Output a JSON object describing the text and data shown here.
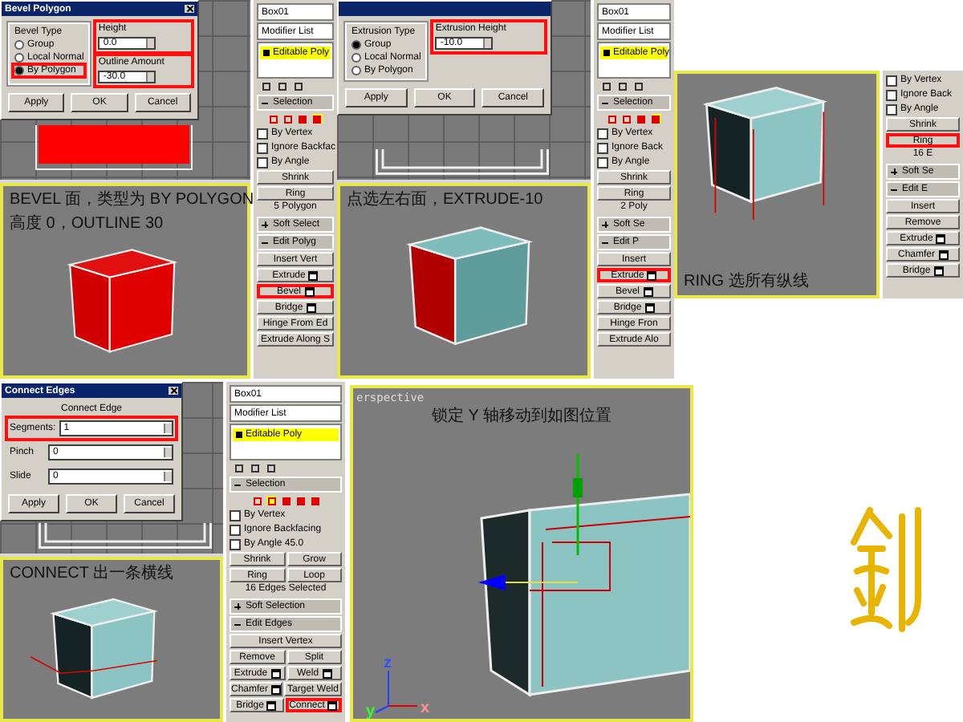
{
  "panels": [
    {
      "dialog": {
        "title": "Bevel Polygon",
        "group_label": "Bevel Type",
        "radios": [
          {
            "label": "Group",
            "selected": false,
            "highlighted": false
          },
          {
            "label": "Local Normal",
            "selected": false,
            "highlighted": false
          },
          {
            "label": "By Polygon",
            "selected": true,
            "highlighted": true
          }
        ],
        "fields": [
          {
            "label": "Height",
            "value": "0.0",
            "highlighted": true
          },
          {
            "label": "Outline Amount",
            "value": "-30.0",
            "highlighted": true
          }
        ],
        "buttons": [
          "Apply",
          "OK",
          "Cancel"
        ]
      },
      "top_view": {
        "kind": "red_plane"
      },
      "viewport": {
        "kind": "bevel_box",
        "captions": [
          "BEVEL 面，类型为 BY POLYGON",
          "高度 0，OUTLINE 30"
        ]
      },
      "command_panel": [
        {
          "kind": "field",
          "text": "Box01"
        },
        {
          "kind": "dropdown",
          "text": "Modifier List"
        },
        {
          "kind": "stack",
          "text": "Editable Poly"
        },
        {
          "kind": "stack_tools"
        },
        {
          "kind": "rollout",
          "text": "Selection",
          "expanded": true
        },
        {
          "kind": "levels",
          "levels": [
            {
              "selected": false
            },
            {
              "selected": false
            },
            {
              "selected": false
            },
            {
              "selected": true
            }
          ]
        },
        {
          "kind": "check",
          "text": "By Vertex",
          "checked": false
        },
        {
          "kind": "check",
          "text": "Ignore Backfac",
          "checked": false
        },
        {
          "kind": "check",
          "text": "By Angle",
          "checked": false
        },
        {
          "kind": "buttons",
          "buttons": [
            {
              "text": "Shrink",
              "settings": false,
              "highlighted": false
            }
          ]
        },
        {
          "kind": "buttons",
          "buttons": [
            {
              "text": "Ring",
              "settings": false,
              "highlighted": false
            }
          ]
        },
        {
          "kind": "note",
          "text": "5 Polygon"
        },
        {
          "kind": "rollout",
          "text": "Soft Select",
          "expanded": false
        },
        {
          "kind": "rollout",
          "text": "Edit Polyg",
          "expanded": true
        },
        {
          "kind": "buttons",
          "buttons": [
            {
              "text": "Insert Vert",
              "settings": false,
              "highlighted": false
            }
          ]
        },
        {
          "kind": "buttons",
          "buttons": [
            {
              "text": "Extrude",
              "settings": true,
              "highlighted": false
            }
          ]
        },
        {
          "kind": "buttons",
          "buttons": [
            {
              "text": "Bevel",
              "settings": true,
              "highlighted": true
            }
          ]
        },
        {
          "kind": "buttons",
          "buttons": [
            {
              "text": "Bridge",
              "settings": true,
              "highlighted": false
            }
          ]
        },
        {
          "kind": "buttons",
          "buttons": [
            {
              "text": "Hinge From Ed",
              "settings": false,
              "highlighted": false
            }
          ]
        },
        {
          "kind": "buttons",
          "buttons": [
            {
              "text": "Extrude Along S",
              "settings": false,
              "highlighted": false
            }
          ]
        }
      ]
    },
    {
      "dialog": {
        "group_label": "Extrusion Type",
        "radios": [
          {
            "label": "Group",
            "selected": true,
            "highlighted": false
          },
          {
            "label": "Local Normal",
            "selected": false,
            "highlighted": false
          },
          {
            "label": "By Polygon",
            "selected": false,
            "highlighted": false
          }
        ],
        "fields": [
          {
            "label": "Extrusion Height",
            "value": "-10.0",
            "highlighted": true
          }
        ],
        "buttons": [
          "Apply",
          "OK",
          "Cancel"
        ]
      },
      "top_view": {
        "kind": "box_outline"
      },
      "viewport": {
        "kind": "extruded_box",
        "captions": [
          "点选左右面，EXTRUDE-10"
        ]
      },
      "command_panel": [
        {
          "kind": "field",
          "text": "Box01"
        },
        {
          "kind": "dropdown",
          "text": "Modifier List"
        },
        {
          "kind": "stack",
          "text": "Editable Poly"
        },
        {
          "kind": "stack_tools"
        },
        {
          "kind": "rollout",
          "text": "Selection",
          "expanded": true
        },
        {
          "kind": "levels",
          "levels": [
            {
              "selected": false
            },
            {
              "selected": false
            },
            {
              "selected": false
            },
            {
              "selected": true
            }
          ]
        },
        {
          "kind": "check",
          "text": "By Vertex",
          "checked": false
        },
        {
          "kind": "check",
          "text": "Ignore Back",
          "checked": false
        },
        {
          "kind": "check",
          "text": "By Angle",
          "checked": false
        },
        {
          "kind": "buttons",
          "buttons": [
            {
              "text": "Shrink",
              "settings": false,
              "highlighted": false
            }
          ]
        },
        {
          "kind": "buttons",
          "buttons": [
            {
              "text": "Ring",
              "settings": false,
              "highlighted": false
            }
          ]
        },
        {
          "kind": "note",
          "text": "2 Poly"
        },
        {
          "kind": "rollout",
          "text": "Soft Se",
          "expanded": false
        },
        {
          "kind": "rollout",
          "text": "Edit P",
          "expanded": true
        },
        {
          "kind": "buttons",
          "buttons": [
            {
              "text": "Insert",
              "settings": false,
              "highlighted": false
            }
          ]
        },
        {
          "kind": "buttons",
          "buttons": [
            {
              "text": "Extrude",
              "settings": true,
              "highlighted": true
            }
          ]
        },
        {
          "kind": "buttons",
          "buttons": [
            {
              "text": "Bevel",
              "settings": true,
              "highlighted": false
            }
          ]
        },
        {
          "kind": "buttons",
          "buttons": [
            {
              "text": "Bridge",
              "settings": true,
              "highlighted": false
            }
          ]
        },
        {
          "kind": "buttons",
          "buttons": [
            {
              "text": "Hinge Fron",
              "settings": false,
              "highlighted": false
            }
          ]
        },
        {
          "kind": "buttons",
          "buttons": [
            {
              "text": "Extrude Alo",
              "settings": false,
              "highlighted": false
            }
          ]
        }
      ]
    },
    {
      "viewport": {
        "kind": "ring_box",
        "captions": [
          "RING 选所有纵线"
        ]
      },
      "command_panel": [
        {
          "kind": "check",
          "text": "By Vertex",
          "checked": false
        },
        {
          "kind": "check",
          "text": "Ignore Back",
          "checked": false
        },
        {
          "kind": "check",
          "text": "By Angle",
          "checked": false
        },
        {
          "kind": "buttons",
          "buttons": [
            {
              "text": "Shrink",
              "settings": false,
              "highlighted": false
            }
          ]
        },
        {
          "kind": "buttons",
          "buttons": [
            {
              "text": "Ring",
              "settings": false,
              "highlighted": true
            }
          ]
        },
        {
          "kind": "note",
          "text": "16 E"
        },
        {
          "kind": "rollout",
          "text": "Soft Se",
          "expanded": false
        },
        {
          "kind": "rollout",
          "text": "Edit E",
          "expanded": true
        },
        {
          "kind": "buttons",
          "buttons": [
            {
              "text": "Insert",
              "settings": false,
              "highlighted": false
            }
          ]
        },
        {
          "kind": "buttons",
          "buttons": [
            {
              "text": "Remove",
              "settings": false,
              "highlighted": false
            }
          ]
        },
        {
          "kind": "buttons",
          "buttons": [
            {
              "text": "Extrude",
              "settings": true,
              "highlighted": false
            }
          ]
        },
        {
          "kind": "buttons",
          "buttons": [
            {
              "text": "Chamfer",
              "settings": true,
              "highlighted": false
            }
          ]
        },
        {
          "kind": "buttons",
          "buttons": [
            {
              "text": "Bridge",
              "settings": true,
              "highlighted": false
            }
          ]
        }
      ]
    },
    {
      "dialog": {
        "title": "Connect Edges",
        "group_label": "Connect Edge",
        "fields": [
          {
            "label": "Segments:",
            "value": "1",
            "highlighted": true
          },
          {
            "label": "Pinch",
            "value": "0",
            "highlighted": false
          },
          {
            "label": "Slide",
            "value": "0",
            "highlighted": false
          }
        ],
        "buttons": [
          "Apply",
          "OK",
          "Cancel"
        ]
      },
      "top_view": {
        "kind": "box_outline"
      },
      "viewport": {
        "kind": "connected_box",
        "captions": [
          "CONNECT 出一条横线"
        ]
      },
      "command_panel": [
        {
          "kind": "field",
          "text": "Box01"
        },
        {
          "kind": "dropdown",
          "text": "Modifier List"
        },
        {
          "kind": "stack",
          "text": "Editable Poly"
        },
        {
          "kind": "stack_tools"
        },
        {
          "kind": "rollout",
          "text": "Selection",
          "expanded": true
        },
        {
          "kind": "levels",
          "levels": [
            {
              "selected": false
            },
            {
              "selected": true
            },
            {
              "selected": false
            },
            {
              "selected": false
            },
            {
              "selected": false
            }
          ]
        },
        {
          "kind": "check",
          "text": "By Vertex",
          "checked": false
        },
        {
          "kind": "check",
          "text": "Ignore Backfacing",
          "checked": false
        },
        {
          "kind": "check",
          "text": "By Angle  45.0",
          "checked": false
        },
        {
          "kind": "buttons",
          "buttons": [
            {
              "text": "Shrink",
              "settings": false,
              "highlighted": false
            },
            {
              "text": "Grow",
              "settings": false,
              "highlighted": false
            }
          ]
        },
        {
          "kind": "buttons",
          "buttons": [
            {
              "text": "Ring",
              "settings": false,
              "highlighted": false
            },
            {
              "text": "Loop",
              "settings": false,
              "highlighted": false
            }
          ]
        },
        {
          "kind": "note",
          "text": "16 Edges Selected"
        },
        {
          "kind": "rollout",
          "text": "Soft Selection",
          "expanded": false
        },
        {
          "kind": "rollout",
          "text": "Edit Edges",
          "expanded": true
        },
        {
          "kind": "buttons",
          "buttons": [
            {
              "text": "Insert Vertex",
              "settings": false,
              "highlighted": false
            }
          ]
        },
        {
          "kind": "buttons",
          "buttons": [
            {
              "text": "Remove",
              "settings": false,
              "highlighted": false
            },
            {
              "text": "Split",
              "settings": false,
              "highlighted": false
            }
          ]
        },
        {
          "kind": "buttons",
          "buttons": [
            {
              "text": "Extrude",
              "settings": true,
              "highlighted": false
            },
            {
              "text": "Weld",
              "settings": true,
              "highlighted": false
            }
          ]
        },
        {
          "kind": "buttons",
          "buttons": [
            {
              "text": "Chamfer",
              "settings": true,
              "highlighted": false
            },
            {
              "text": "Target Weld",
              "settings": false,
              "highlighted": false
            }
          ]
        },
        {
          "kind": "buttons",
          "buttons": [
            {
              "text": "Bridge",
              "settings": true,
              "highlighted": false
            },
            {
              "text": "Connect",
              "settings": true,
              "highlighted": true
            }
          ]
        }
      ]
    },
    {
      "viewport": {
        "label": "erspective",
        "kind": "moved_box",
        "captions": [
          "锁定 Y 轴移动到如图位置"
        ],
        "axis_labels": [
          "z",
          "y",
          "x"
        ]
      }
    }
  ]
}
